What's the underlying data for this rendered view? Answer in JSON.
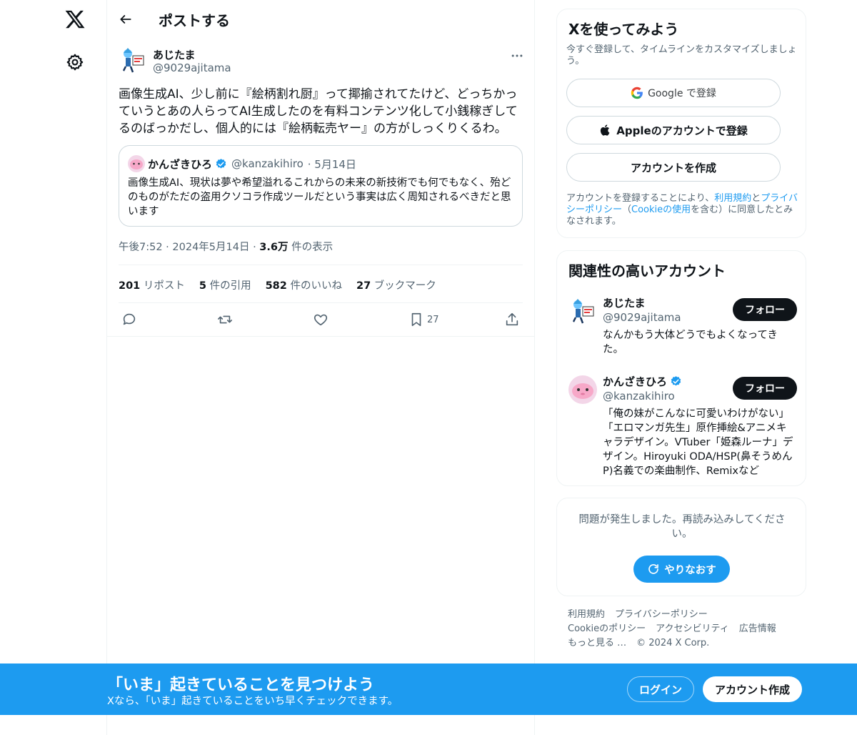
{
  "colors": {
    "accent": "#1d9bf0",
    "text": "#0f1419",
    "muted": "#536471",
    "border": "#eff3f4"
  },
  "header": {
    "title": "ポストする"
  },
  "post": {
    "author": {
      "name": "あじたま",
      "handle": "@9029ajitama"
    },
    "text": "画像生成AI、少し前に『絵柄割れ厨』って揶揄されてたけど、どっちかっていうとあの人らってAI生成したのを有料コンテンツ化して小銭稼ぎしてるのばっかだし、個人的には『絵柄転売ヤー』の方がしっくりくるわ。",
    "quote": {
      "name": "かんざきひろ",
      "handle": "@kanzakihiro",
      "date": "· 5月14日",
      "text": "画像生成AI、現状は夢や希望溢れるこれからの未来の新技術でも何でもなく、殆どのものがただの盗用クソコラ作成ツールだという事実は広く周知されるべきだと思います"
    },
    "time": "午後7:52 · 2024年5月14日 · ",
    "views": "3.6万",
    "views_label": " 件の表示",
    "stats": {
      "reposts": "201",
      "reposts_label": " リポスト",
      "quotes": "5",
      "quotes_label": " 件の引用",
      "likes": "582",
      "likes_label": " 件のいいね",
      "bookmarks": "27",
      "bookmarks_label": " ブックマーク"
    },
    "bookmark_count": "27"
  },
  "sidebar": {
    "signup": {
      "title": "Xを使ってみよう",
      "subtitle": "今すぐ登録して、タイムラインをカスタマイズしましょう。",
      "google": "Google で登録",
      "apple": "Appleのアカウントで登録",
      "create": "アカウントを作成",
      "legal_1": "アカウントを登録することにより、",
      "legal_terms": "利用規約",
      "legal_2": "と",
      "legal_privacy": "プライバシーポリシー",
      "legal_3": "（",
      "legal_cookie": "Cookieの使用",
      "legal_4": "を含む）に同意したとみなされます。"
    },
    "related": {
      "title": "関連性の高いアカウント",
      "accounts": [
        {
          "name": "あじたま",
          "handle": "@9029ajitama",
          "bio": "なんかもう大体どうでもよくなってきた。",
          "follow": "フォロー"
        },
        {
          "name": "かんざきひろ",
          "handle": "@kanzakihiro",
          "bio": "「俺の妹がこんなに可愛いわけがない」「エロマンガ先生」原作挿絵&アニメキャラデザイン。VTuber「姫森ルーナ」デザイン。Hiroyuki ODA/HSP(鼻そうめんP)名義での楽曲制作、Remixなど",
          "follow": "フォロー"
        }
      ]
    },
    "error": {
      "message": "問題が発生しました。再読み込みしてください。",
      "retry": "やりなおす"
    },
    "footer": {
      "terms": "利用規約",
      "privacy": "プライバシーポリシー",
      "cookie": "Cookieのポリシー",
      "accessibility": "アクセシビリティ",
      "ads": "広告情報",
      "more": "もっと見る …",
      "copyright": "© 2024 X Corp."
    }
  },
  "banner": {
    "headline": "「いま」起きていることを見つけよう",
    "sub": "Xなら、「いま」起きていることをいち早くチェックできます。",
    "login": "ログイン",
    "join": "アカウント作成"
  }
}
